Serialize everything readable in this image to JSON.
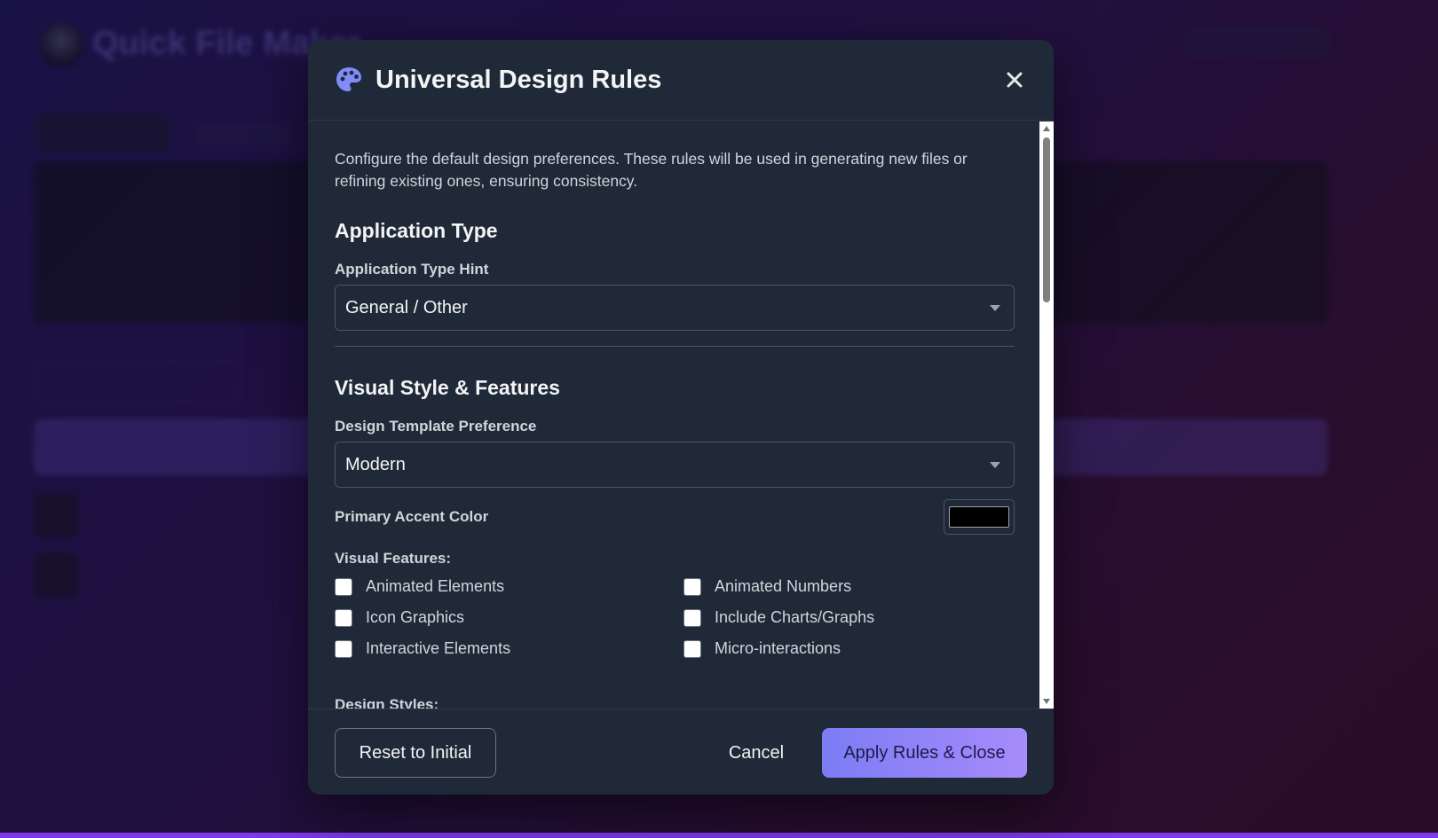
{
  "background_app": {
    "title": "Quick File Maker"
  },
  "modal": {
    "title": "Universal Design Rules",
    "icon": "palette-icon",
    "close_icon": "close-icon",
    "intro": "Configure the default design preferences. These rules will be used in generating new files or refining existing ones, ensuring consistency.",
    "application_type": {
      "heading": "Application Type",
      "hint_label": "Application Type Hint",
      "hint_value": "General / Other"
    },
    "visual_style": {
      "heading": "Visual Style & Features",
      "template_label": "Design Template Preference",
      "template_value": "Modern",
      "accent_label": "Primary Accent Color",
      "accent_color": "#000000",
      "features_label": "Visual Features:",
      "features": [
        {
          "label": "Animated Elements",
          "checked": false
        },
        {
          "label": "Animated Numbers",
          "checked": false
        },
        {
          "label": "Icon Graphics",
          "checked": false
        },
        {
          "label": "Include Charts/Graphs",
          "checked": false
        },
        {
          "label": "Interactive Elements",
          "checked": false
        },
        {
          "label": "Micro-interactions",
          "checked": false
        }
      ],
      "design_styles_label": "Design Styles:"
    },
    "footer": {
      "reset_label": "Reset to Initial",
      "cancel_label": "Cancel",
      "apply_label": "Apply Rules & Close"
    }
  },
  "colors": {
    "accent": "#7c7cf5",
    "modal_bg": "#1f2937",
    "palette_icon": "#818cf8"
  }
}
